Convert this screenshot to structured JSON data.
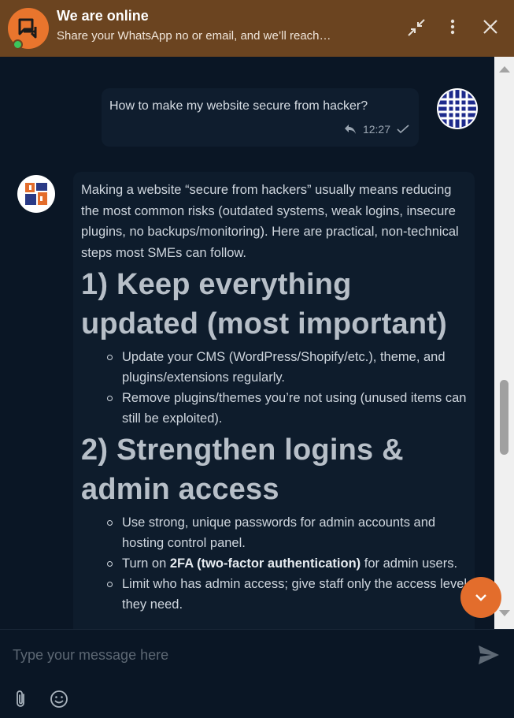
{
  "header": {
    "title": "We are online",
    "subtitle": "Share your WhatsApp no or email, and we’ll reach…",
    "accent": "#6b4420",
    "avatar_color": "#e9752d",
    "online_color": "#3cc55b",
    "icons": [
      "chat-icon",
      "minimize-icon",
      "more-icon",
      "close-icon"
    ]
  },
  "user_message": {
    "text": "How to make my website secure from hacker?",
    "time": "12:27"
  },
  "bot_message": {
    "intro": "Making a website “secure from hackers” usually means reducing the most common risks (outdated systems, weak logins, insecure plugins, no backups/monitoring). Here are practical, non-technical steps most SMEs can follow.",
    "sections": [
      {
        "heading": "1) Keep everything updated (most important)",
        "items": [
          "Update your CMS (WordPress/Shopify/etc.), theme, and plugins/extensions regularly.",
          "Remove plugins/themes you’re not using (unused items can still be exploited)."
        ]
      },
      {
        "heading": "2) Strengthen logins & admin access",
        "items": [
          "Use strong, unique passwords for admin accounts and hosting control panel.",
          {
            "prefix": "Turn on ",
            "bold": "2FA (two-factor authentication)",
            "suffix": " for admin users."
          },
          "Limit who has admin access; give staff only the access level they need."
        ]
      }
    ]
  },
  "composer": {
    "placeholder": "Type your message here"
  },
  "fab_color": "#e36d2c"
}
